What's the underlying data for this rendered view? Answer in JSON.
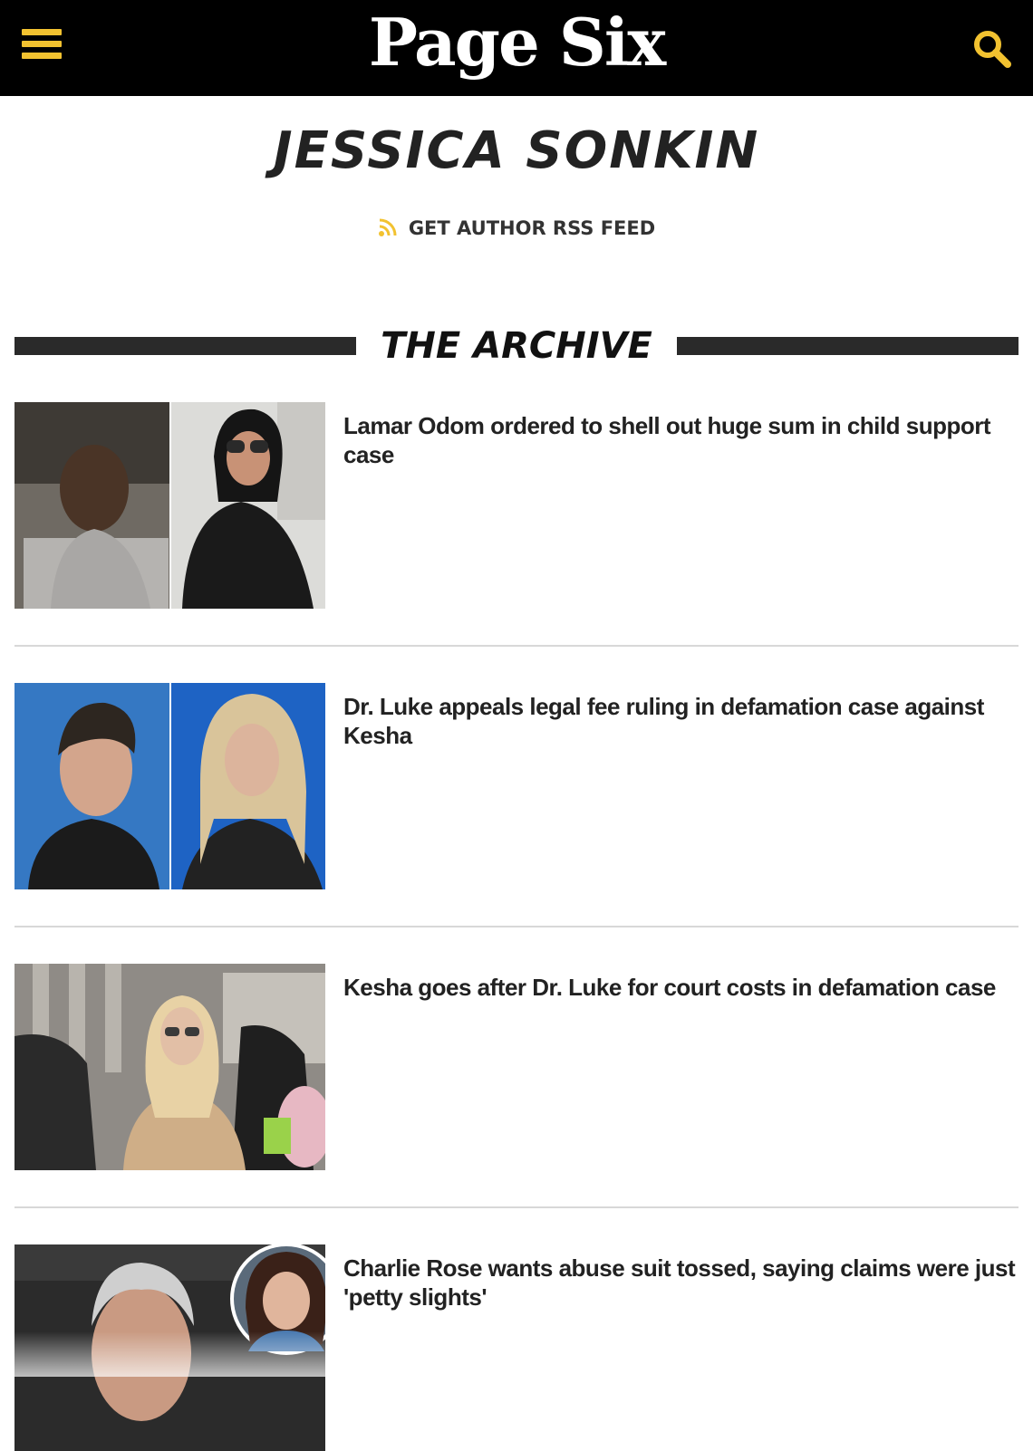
{
  "header": {
    "logo": "Page Six",
    "menu_icon": "hamburger-menu-icon",
    "search_icon": "search-icon",
    "accent_color": "#f2c230",
    "background_color": "#000000"
  },
  "author": {
    "name": "JESSICA SONKIN",
    "rss_label": "GET AUTHOR RSS FEED",
    "rss_icon": "rss-icon"
  },
  "archive": {
    "title": "THE ARCHIVE"
  },
  "articles": [
    {
      "headline": "Lamar Odom ordered to shell out huge sum in child support case"
    },
    {
      "headline": "Dr. Luke appeals legal fee ruling in defamation case against Kesha"
    },
    {
      "headline": "Kesha goes after Dr. Luke for court costs in defamation case"
    },
    {
      "headline": "Charlie Rose wants abuse suit tossed, saying claims were just 'petty slights'"
    }
  ]
}
